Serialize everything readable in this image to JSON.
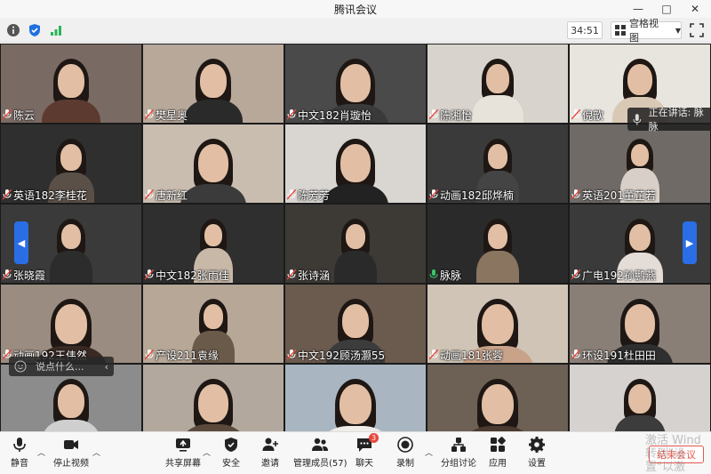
{
  "window": {
    "title": "腾讯会议"
  },
  "infobar": {
    "timer": "34:51",
    "view_label": "宫格视图"
  },
  "participants": [
    {
      "name": "陈云"
    },
    {
      "name": "樊星奥"
    },
    {
      "name": "中文182肖璇怡"
    },
    {
      "name": "陈湘怡"
    },
    {
      "name": "倪歆"
    },
    {
      "name": "英语182李桂花"
    },
    {
      "name": "唐新红"
    },
    {
      "name": "陈芳芳"
    },
    {
      "name": "动画182邱烨楠"
    },
    {
      "name": "英语201董芷若"
    },
    {
      "name": "张晓霞"
    },
    {
      "name": "中文182张雨佳"
    },
    {
      "name": "张诗涵"
    },
    {
      "name": "脉脉"
    },
    {
      "name": "广电192孙鹏燕"
    },
    {
      "name": "动画192王伟然"
    },
    {
      "name": "产设211袁缘"
    },
    {
      "name": "中文192顾汤灏55"
    },
    {
      "name": "动画181张蓉"
    },
    {
      "name": "环设191杜田田"
    },
    {
      "name": ""
    },
    {
      "name": ""
    },
    {
      "name": ""
    },
    {
      "name": ""
    },
    {
      "name": ""
    }
  ],
  "speaking": {
    "label": "正在讲话: 脉脉"
  },
  "chat": {
    "placeholder": "说点什么..."
  },
  "toolbar": {
    "mute": "静音",
    "stop_video": "停止视频",
    "share_screen": "共享屏幕",
    "security": "安全",
    "invite": "邀请",
    "members": "管理成员(57)",
    "chat": "聊天",
    "chat_badge": "3",
    "record": "录制",
    "breakout": "分组讨论",
    "apps": "应用",
    "settings": "设置",
    "end": "结束会议"
  },
  "watermark": {
    "line1": "激活 Wind",
    "line2": "转到\"设置\"以激"
  }
}
